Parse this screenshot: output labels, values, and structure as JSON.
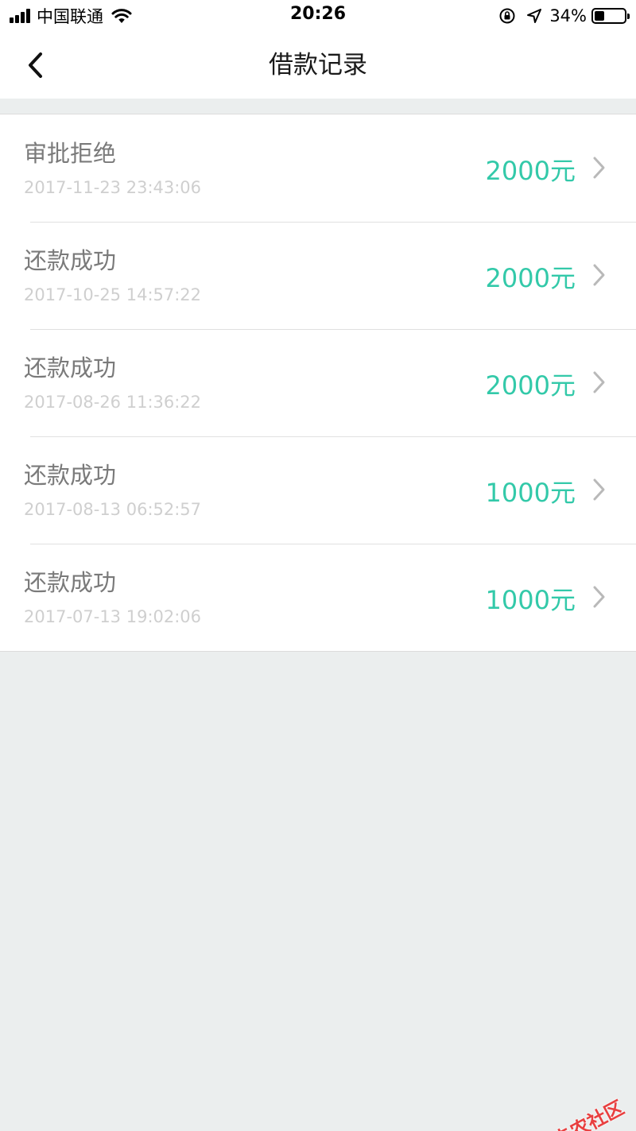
{
  "status_bar": {
    "carrier": "中国联通",
    "time": "20:26",
    "battery_percent": "34%",
    "battery_level": 0.34
  },
  "nav": {
    "title": "借款记录",
    "back_icon": "chevron-left-icon"
  },
  "records": [
    {
      "status": "审批拒绝",
      "datetime": "2017-11-23 23:43:06",
      "amount": "2000元"
    },
    {
      "status": "还款成功",
      "datetime": "2017-10-25 14:57:22",
      "amount": "2000元"
    },
    {
      "status": "还款成功",
      "datetime": "2017-08-26 11:36:22",
      "amount": "2000元"
    },
    {
      "status": "还款成功",
      "datetime": "2017-08-13 06:52:57",
      "amount": "1000元"
    },
    {
      "status": "还款成功",
      "datetime": "2017-07-13 19:02:06",
      "amount": "1000元"
    }
  ],
  "watermark": {
    "text": "卡农社区"
  },
  "colors": {
    "accent": "#33c9a9",
    "background": "#ebeeee",
    "watermark": "#e84040"
  }
}
